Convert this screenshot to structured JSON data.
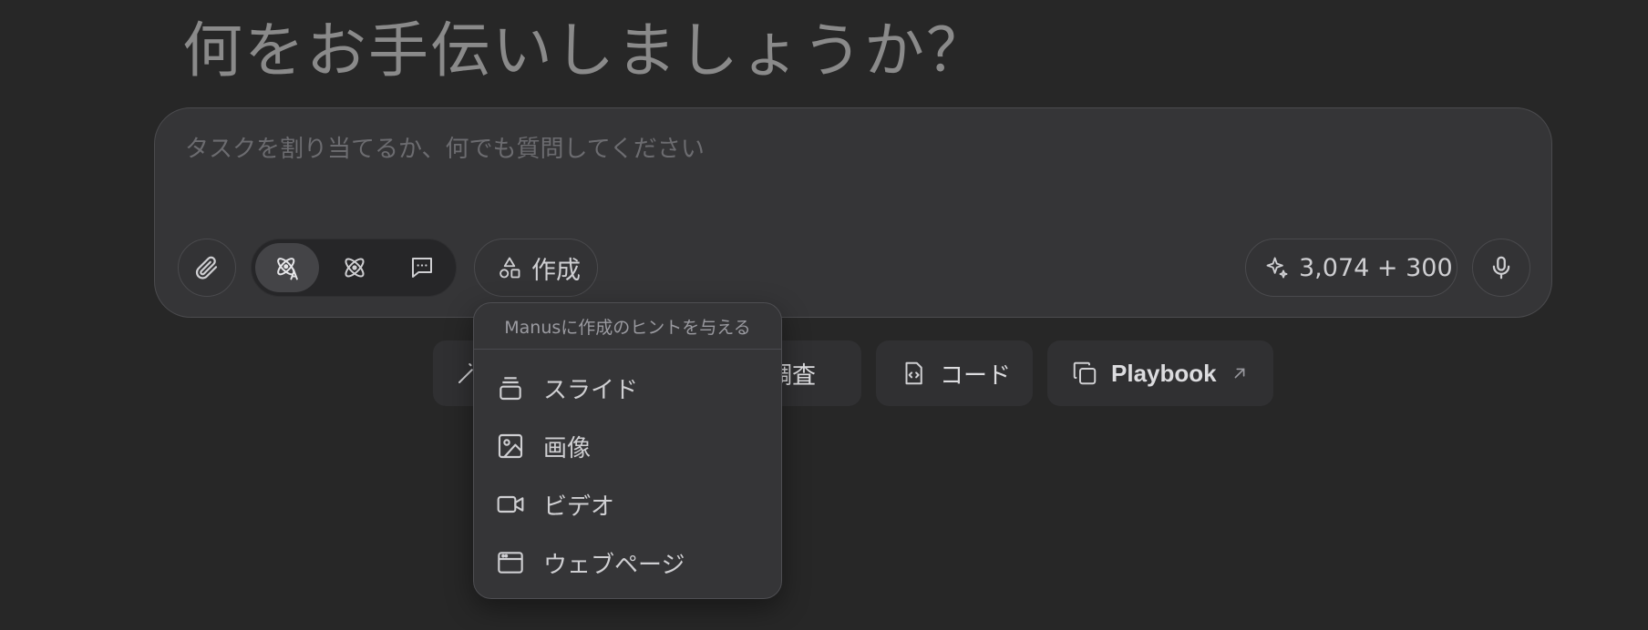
{
  "heading": "何をお手伝いしましょうか？",
  "composer": {
    "placeholder": "タスクを割り当てるか、何でも質問してください",
    "value": "",
    "create_label": "作成",
    "credits": "3,074 + 300"
  },
  "modes": [
    {
      "icon": "agent-atom-icon",
      "active": true
    },
    {
      "icon": "atom-icon",
      "active": false
    },
    {
      "icon": "chat-icon",
      "active": false
    }
  ],
  "quick_actions": [
    {
      "label": "調査",
      "icon": "search-icon"
    },
    {
      "label": "コード",
      "icon": "code-file-icon"
    },
    {
      "label": "Playbook",
      "icon": "copy-icon",
      "external_icon": "arrow-up-right-icon"
    }
  ],
  "create_menu": {
    "header": "Manusに作成のヒントを与える",
    "items": [
      {
        "label": "スライド",
        "icon": "slides-icon"
      },
      {
        "label": "画像",
        "icon": "image-icon"
      },
      {
        "label": "ビデオ",
        "icon": "video-icon"
      },
      {
        "label": "ウェブページ",
        "icon": "webpage-icon"
      }
    ]
  },
  "colors": {
    "background": "#272727",
    "composer": "#353537",
    "text": "#d6d6d6",
    "muted": "#6c6c70"
  }
}
